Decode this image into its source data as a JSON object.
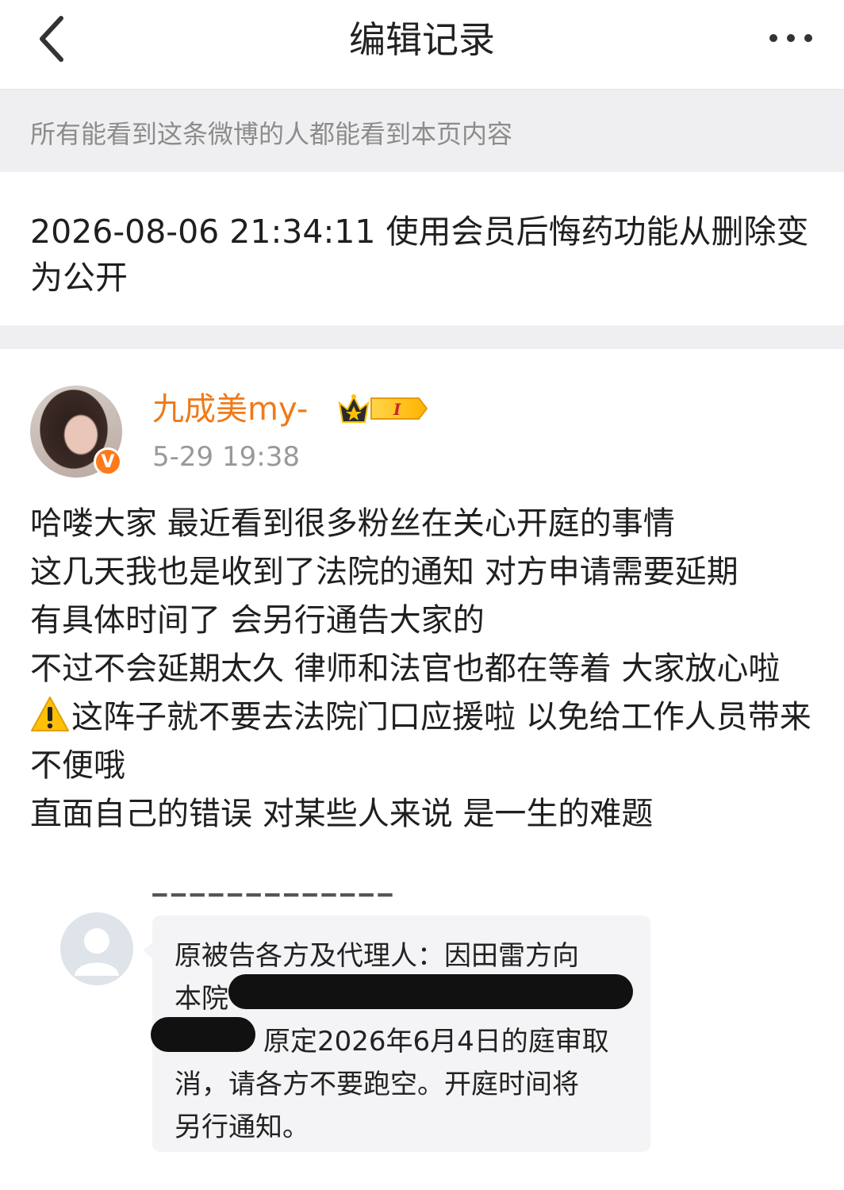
{
  "nav": {
    "title": "编辑记录",
    "back_icon": "chevron-left-icon",
    "more_icon": "more-dots-icon"
  },
  "notice": {
    "text": "所有能看到这条微博的人都能看到本页内容"
  },
  "record": {
    "text": "2026-08-06 21:34:11 使用会员后悔药功能从删除变为公开"
  },
  "post": {
    "username": "九成美my-",
    "verified_badge": "V",
    "vip_level": "I",
    "time": "5-29 19:38",
    "lines": [
      "哈喽大家 最近看到很多粉丝在关心开庭的事情",
      "这几天我也是收到了法院的通知 对方申请需要延期",
      "有具体时间了 会另行通告大家的",
      "不过不会延期太久 律师和法官也都在等着 大家放心啦",
      "这阵子就不要去法院门口应援啦 以免给工作人员带来不便哦",
      "直面自己的错误 对某些人来说 是一生的难题"
    ],
    "warning_icon": "warning-icon"
  },
  "message": {
    "line1": "原被告各方及代理人：因田雷方向",
    "line2": "本院",
    "line3": "原定2026年6月4日的庭审取",
    "line4": "消，请各方不要跑空。开庭时间将",
    "line5": "另行通知。"
  },
  "colors": {
    "username": "#f07a19",
    "verified": "#ff7a1a",
    "background_gray": "#efeff1"
  }
}
